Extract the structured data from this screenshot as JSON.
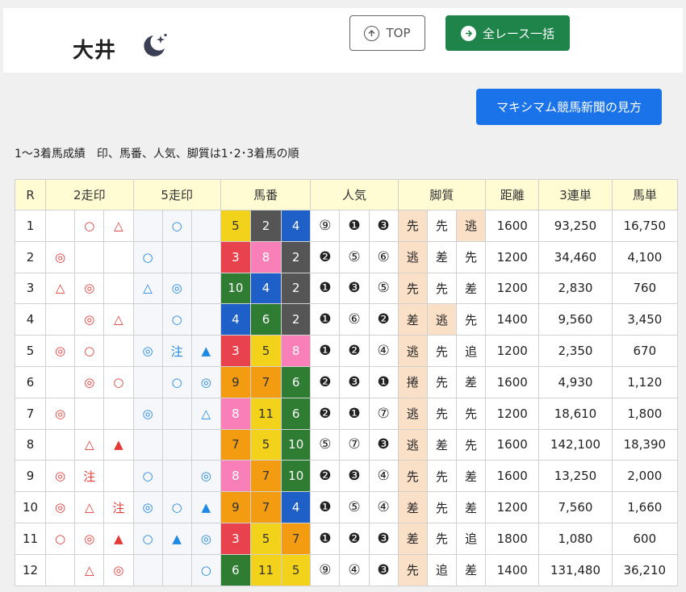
{
  "header": {
    "venue": "大井",
    "top_label": "TOP",
    "all_races_label": "全レース一括"
  },
  "guide_label": "マキシマム競馬新聞の見方",
  "caption": "1〜3着馬成績　印、馬番、人気、脚質は1･2･3着馬の順",
  "table": {
    "headers": [
      "R",
      "2走印",
      "5走印",
      "馬番",
      "人気",
      "脚質",
      "距離",
      "3連単",
      "馬単"
    ],
    "rows": [
      {
        "r": "1",
        "m2": [
          "",
          "○",
          "△"
        ],
        "m5": [
          "",
          "○",
          ""
        ],
        "num": [
          "5",
          "2",
          "4"
        ],
        "pop": [
          "⑨",
          "❶",
          "❸"
        ],
        "legs": [
          "先",
          "先",
          "逃"
        ],
        "dist": "1600",
        "trifecta": "93,250",
        "exacta": "16,750"
      },
      {
        "r": "2",
        "m2": [
          "◎",
          "",
          ""
        ],
        "m5": [
          "○",
          "",
          ""
        ],
        "num": [
          "3",
          "8",
          "2"
        ],
        "pop": [
          "❷",
          "⑤",
          "⑥"
        ],
        "legs": [
          "逃",
          "差",
          "先"
        ],
        "dist": "1200",
        "trifecta": "34,460",
        "exacta": "4,100"
      },
      {
        "r": "3",
        "m2": [
          "△",
          "◎",
          ""
        ],
        "m5": [
          "△",
          "◎",
          ""
        ],
        "num": [
          "10",
          "4",
          "2"
        ],
        "pop": [
          "❶",
          "❸",
          "⑤"
        ],
        "legs": [
          "先",
          "先",
          "差"
        ],
        "dist": "1200",
        "trifecta": "2,830",
        "exacta": "760"
      },
      {
        "r": "4",
        "m2": [
          "",
          "◎",
          "△"
        ],
        "m5": [
          "",
          "○",
          ""
        ],
        "num": [
          "4",
          "6",
          "2"
        ],
        "pop": [
          "❶",
          "⑥",
          "❷"
        ],
        "legs": [
          "差",
          "逃",
          "先"
        ],
        "dist": "1400",
        "trifecta": "9,560",
        "exacta": "3,450"
      },
      {
        "r": "5",
        "m2": [
          "◎",
          "○",
          ""
        ],
        "m5": [
          "◎",
          "注",
          "▲"
        ],
        "num": [
          "3",
          "5",
          "8"
        ],
        "pop": [
          "❶",
          "❷",
          "④"
        ],
        "legs": [
          "逃",
          "先",
          "追"
        ],
        "dist": "1200",
        "trifecta": "2,350",
        "exacta": "670"
      },
      {
        "r": "6",
        "m2": [
          "",
          "◎",
          "○"
        ],
        "m5": [
          "",
          "○",
          "◎"
        ],
        "num": [
          "9",
          "7",
          "6"
        ],
        "pop": [
          "❷",
          "❸",
          "❶"
        ],
        "legs": [
          "捲",
          "先",
          "差"
        ],
        "dist": "1600",
        "trifecta": "4,930",
        "exacta": "1,120"
      },
      {
        "r": "7",
        "m2": [
          "◎",
          "",
          ""
        ],
        "m5": [
          "◎",
          "",
          "△"
        ],
        "num": [
          "8",
          "11",
          "6"
        ],
        "pop": [
          "❷",
          "❶",
          "⑦"
        ],
        "legs": [
          "逃",
          "先",
          "先"
        ],
        "dist": "1200",
        "trifecta": "18,610",
        "exacta": "1,800"
      },
      {
        "r": "8",
        "m2": [
          "",
          "△",
          "▲"
        ],
        "m5": [
          "",
          "",
          ""
        ],
        "num": [
          "7",
          "5",
          "10"
        ],
        "pop": [
          "⑤",
          "⑦",
          "❸"
        ],
        "legs": [
          "逃",
          "差",
          "先"
        ],
        "dist": "1600",
        "trifecta": "142,100",
        "exacta": "18,390"
      },
      {
        "r": "9",
        "m2": [
          "◎",
          "注",
          ""
        ],
        "m5": [
          "○",
          "",
          "◎"
        ],
        "num": [
          "8",
          "7",
          "10"
        ],
        "pop": [
          "❷",
          "❸",
          "④"
        ],
        "legs": [
          "先",
          "先",
          "差"
        ],
        "dist": "1600",
        "trifecta": "13,250",
        "exacta": "2,000"
      },
      {
        "r": "10",
        "m2": [
          "◎",
          "△",
          "注"
        ],
        "m5": [
          "◎",
          "○",
          "▲"
        ],
        "num": [
          "9",
          "7",
          "4"
        ],
        "pop": [
          "❶",
          "⑤",
          "④"
        ],
        "legs": [
          "差",
          "先",
          "差"
        ],
        "dist": "1200",
        "trifecta": "7,560",
        "exacta": "1,660"
      },
      {
        "r": "11",
        "m2": [
          "○",
          "◎",
          "▲"
        ],
        "m5": [
          "○",
          "▲",
          "◎"
        ],
        "num": [
          "3",
          "5",
          "7"
        ],
        "pop": [
          "❶",
          "❷",
          "❸"
        ],
        "legs": [
          "差",
          "先",
          "追"
        ],
        "dist": "1800",
        "trifecta": "1,080",
        "exacta": "600"
      },
      {
        "r": "12",
        "m2": [
          "",
          "△",
          "◎"
        ],
        "m5": [
          "",
          "",
          "○"
        ],
        "num": [
          "6",
          "11",
          "5"
        ],
        "pop": [
          "⑨",
          "④",
          "❸"
        ],
        "legs": [
          "先",
          "追",
          "差"
        ],
        "dist": "1400",
        "trifecta": "131,480",
        "exacta": "36,210"
      }
    ]
  },
  "colors": {
    "mark_2": "#e53935",
    "mark_5": "#1e88e5",
    "highlight_leg": "#fbe0c8",
    "horse_numbers": {
      "1": "#ffffff",
      "2": "#555555",
      "3": "#e8424f",
      "4": "#1f5fc8",
      "5": "#f2d21a",
      "6": "#2e7d32",
      "7": "#f39c12",
      "8": "#f87fb8",
      "9": "#f39c12",
      "10": "#2e7d32",
      "11": "#f2d21a",
      "12": "#f87fb8"
    }
  }
}
